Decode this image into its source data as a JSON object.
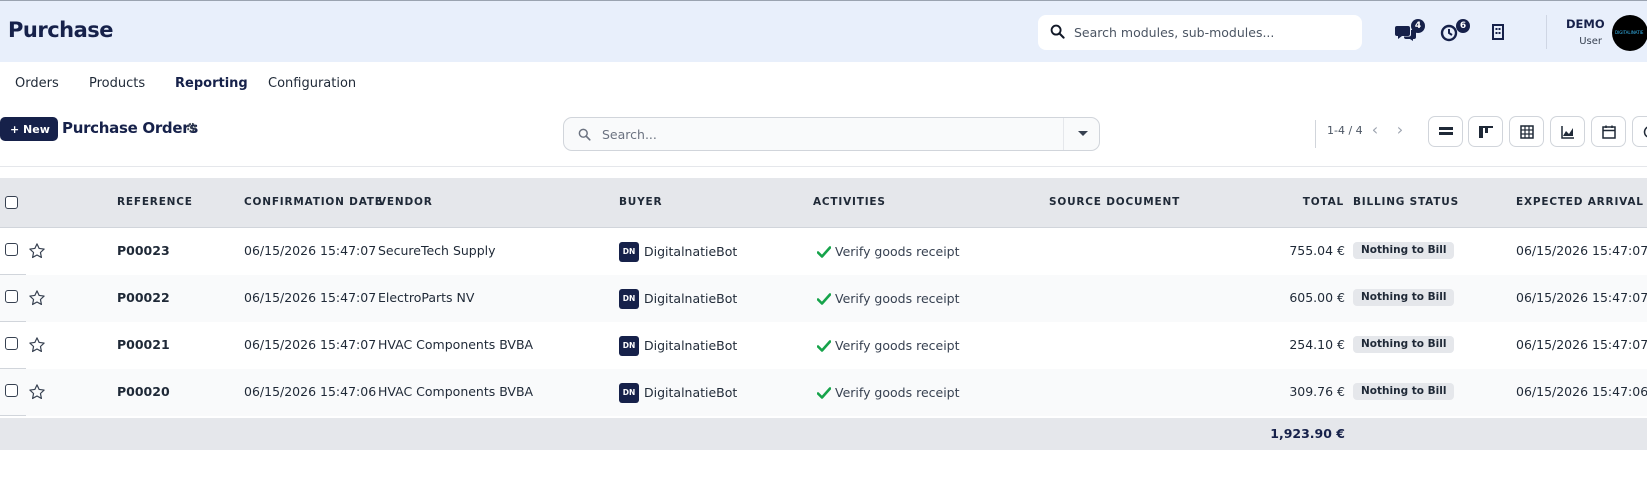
{
  "header": {
    "app_title": "Purchase",
    "search_placeholder": "Search modules, sub-modules...",
    "chat_badge": "4",
    "activity_badge": "6",
    "user_name": "DEMO",
    "user_role": "User",
    "avatar_text": "DIGITALINATIE"
  },
  "nav": {
    "orders": "Orders",
    "products": "Products",
    "reporting": "Reporting",
    "configuration": "Configuration"
  },
  "control": {
    "new_label": "+ New",
    "page_title": "Purchase Orders",
    "search_placeholder": "Search...",
    "pager": "1-4 / 4"
  },
  "table": {
    "columns": {
      "reference": "REFERENCE",
      "confirmation_date": "CONFIRMATION DATE",
      "vendor": "VENDOR",
      "buyer": "BUYER",
      "activities": "ACTIVITIES",
      "source_document": "SOURCE DOCUMENT",
      "total": "TOTAL",
      "billing_status": "BILLING STATUS",
      "expected_arrival": "EXPECTED ARRIVAL"
    },
    "rows": [
      {
        "reference": "P00023",
        "confirmation_date": "06/15/2026 15:47:07",
        "vendor": "SecureTech Supply",
        "buyer_initials": "DN",
        "buyer": "DigitalnatieBot",
        "activity": "Verify goods receipt",
        "total": "755.04 €",
        "billing_status": "Nothing to Bill",
        "expected_arrival": "06/15/2026 15:47:07"
      },
      {
        "reference": "P00022",
        "confirmation_date": "06/15/2026 15:47:07",
        "vendor": "ElectroParts NV",
        "buyer_initials": "DN",
        "buyer": "DigitalnatieBot",
        "activity": "Verify goods receipt",
        "total": "605.00 €",
        "billing_status": "Nothing to Bill",
        "expected_arrival": "06/15/2026 15:47:07"
      },
      {
        "reference": "P00021",
        "confirmation_date": "06/15/2026 15:47:07",
        "vendor": "HVAC Components BVBA",
        "buyer_initials": "DN",
        "buyer": "DigitalnatieBot",
        "activity": "Verify goods receipt",
        "total": "254.10 €",
        "billing_status": "Nothing to Bill",
        "expected_arrival": "06/15/2026 15:47:07"
      },
      {
        "reference": "P00020",
        "confirmation_date": "06/15/2026 15:47:06",
        "vendor": "HVAC Components BVBA",
        "buyer_initials": "DN",
        "buyer": "DigitalnatieBot",
        "activity": "Verify goods receipt",
        "total": "309.76 €",
        "billing_status": "Nothing to Bill",
        "expected_arrival": "06/15/2026 15:47:06"
      }
    ],
    "footer_total": "1,923.90 €"
  },
  "colors": {
    "brand": "#16214a",
    "header_bg": "#e8effb",
    "activity_check": "#16a34a"
  }
}
